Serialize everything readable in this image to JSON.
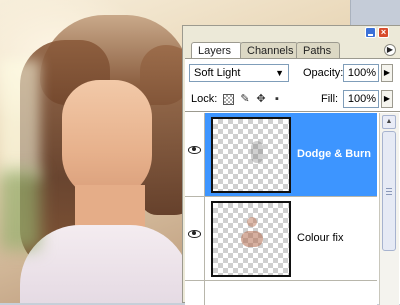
{
  "panel": {
    "tabs": [
      {
        "label": "Layers",
        "active": true
      },
      {
        "label": "Channels",
        "active": false
      },
      {
        "label": "Paths",
        "active": false
      }
    ],
    "blend_mode": "Soft Light",
    "opacity_label": "Opacity:",
    "opacity_value": "100%",
    "lock_label": "Lock:",
    "fill_label": "Fill:",
    "fill_value": "100%",
    "layers": [
      {
        "name": "Dodge & Burn",
        "selected": true,
        "visible": true
      },
      {
        "name": "Colour fix",
        "selected": false,
        "visible": true
      }
    ]
  },
  "colors": {
    "selection": "#3d95ff",
    "panel_bg": "#ece9d8",
    "close_button": "#d84b2c",
    "minimize_button": "#3c71d8"
  },
  "icons": {
    "close": "close-icon",
    "minimize": "minimize-icon",
    "menu": "panel-menu-icon",
    "lock_transparency": "lock-transparency-icon",
    "lock_brush": "brush-icon",
    "lock_move": "move-icon",
    "lock_all": "lock-icon",
    "visibility": "eye-icon"
  }
}
